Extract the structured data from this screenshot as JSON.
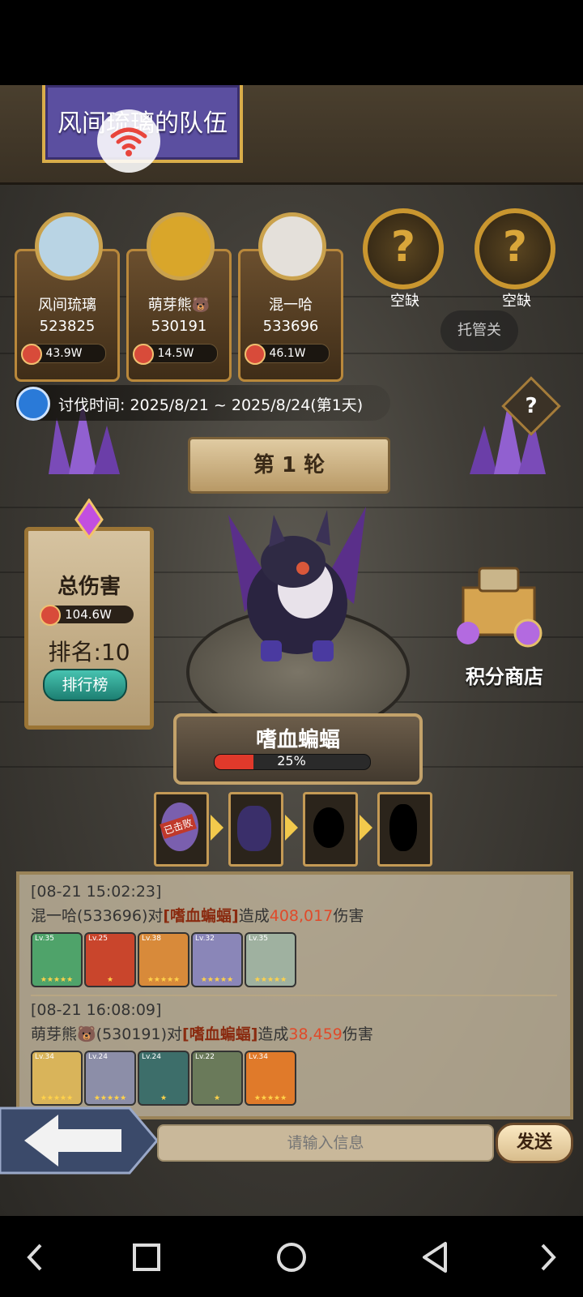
{
  "banner": {
    "title": "风间琉璃的队伍"
  },
  "party": [
    {
      "name": "风间琉璃",
      "score": "523825",
      "power": "43.9W"
    },
    {
      "name": "萌芽熊🐻",
      "score": "530191",
      "power": "14.5W"
    },
    {
      "name": "混一哈",
      "score": "533696",
      "power": "46.1W"
    }
  ],
  "empty_slots": [
    "空缺",
    "空缺"
  ],
  "auto_button": "托管关",
  "event_time": "讨伐时间: 2025/8/21 ~ 2025/8/24(第1天)",
  "help_glyph": "?",
  "round_label": "第 1 轮",
  "damage_panel": {
    "title": "总伤害",
    "value": "104.6W",
    "rank": "排名:10",
    "leaderboard_button": "排行榜"
  },
  "shop_label": "积分商店",
  "boss": {
    "name": "嗜血蝙蝠",
    "hp_percent": 25,
    "hp_text": "25%"
  },
  "stages": {
    "defeated_tag": "已击败"
  },
  "log": [
    {
      "time": "[08-21 15:02:23]",
      "player": "混一哈(533696)对",
      "boss": "[嗜血蝙蝠]",
      "mid": "造成",
      "damage": "408,017",
      "suffix": "伤害",
      "heroes": [
        {
          "level": "Lv.35",
          "stars": "★★★★★",
          "color": "#4fa36a"
        },
        {
          "level": "Lv.25",
          "stars": "★",
          "color": "#c9452c"
        },
        {
          "level": "Lv.38",
          "stars": "★★★★★",
          "color": "#d88a3a"
        },
        {
          "level": "Lv.32",
          "stars": "★★★★★",
          "color": "#8a86b8"
        },
        {
          "level": "Lv.35",
          "stars": "★★★★★",
          "color": "#9fb1a0"
        }
      ]
    },
    {
      "time": "[08-21 16:08:09]",
      "player": "萌芽熊🐻(530191)对",
      "boss": "[嗜血蝙蝠]",
      "mid": "造成",
      "damage": "38,459",
      "suffix": "伤害",
      "heroes": [
        {
          "level": "Lv.34",
          "stars": "★★★★★",
          "color": "#d9b45a"
        },
        {
          "level": "Lv.24",
          "stars": "★★★★★",
          "color": "#8c8ea8"
        },
        {
          "level": "Lv.24",
          "stars": "★",
          "color": "#3d6e6a"
        },
        {
          "level": "Lv.22",
          "stars": "★",
          "color": "#6a7a5a"
        },
        {
          "level": "Lv.34",
          "stars": "★★★★★",
          "color": "#e07a2a"
        }
      ]
    }
  ],
  "chat": {
    "placeholder": "请输入信息",
    "send_label": "发送"
  }
}
